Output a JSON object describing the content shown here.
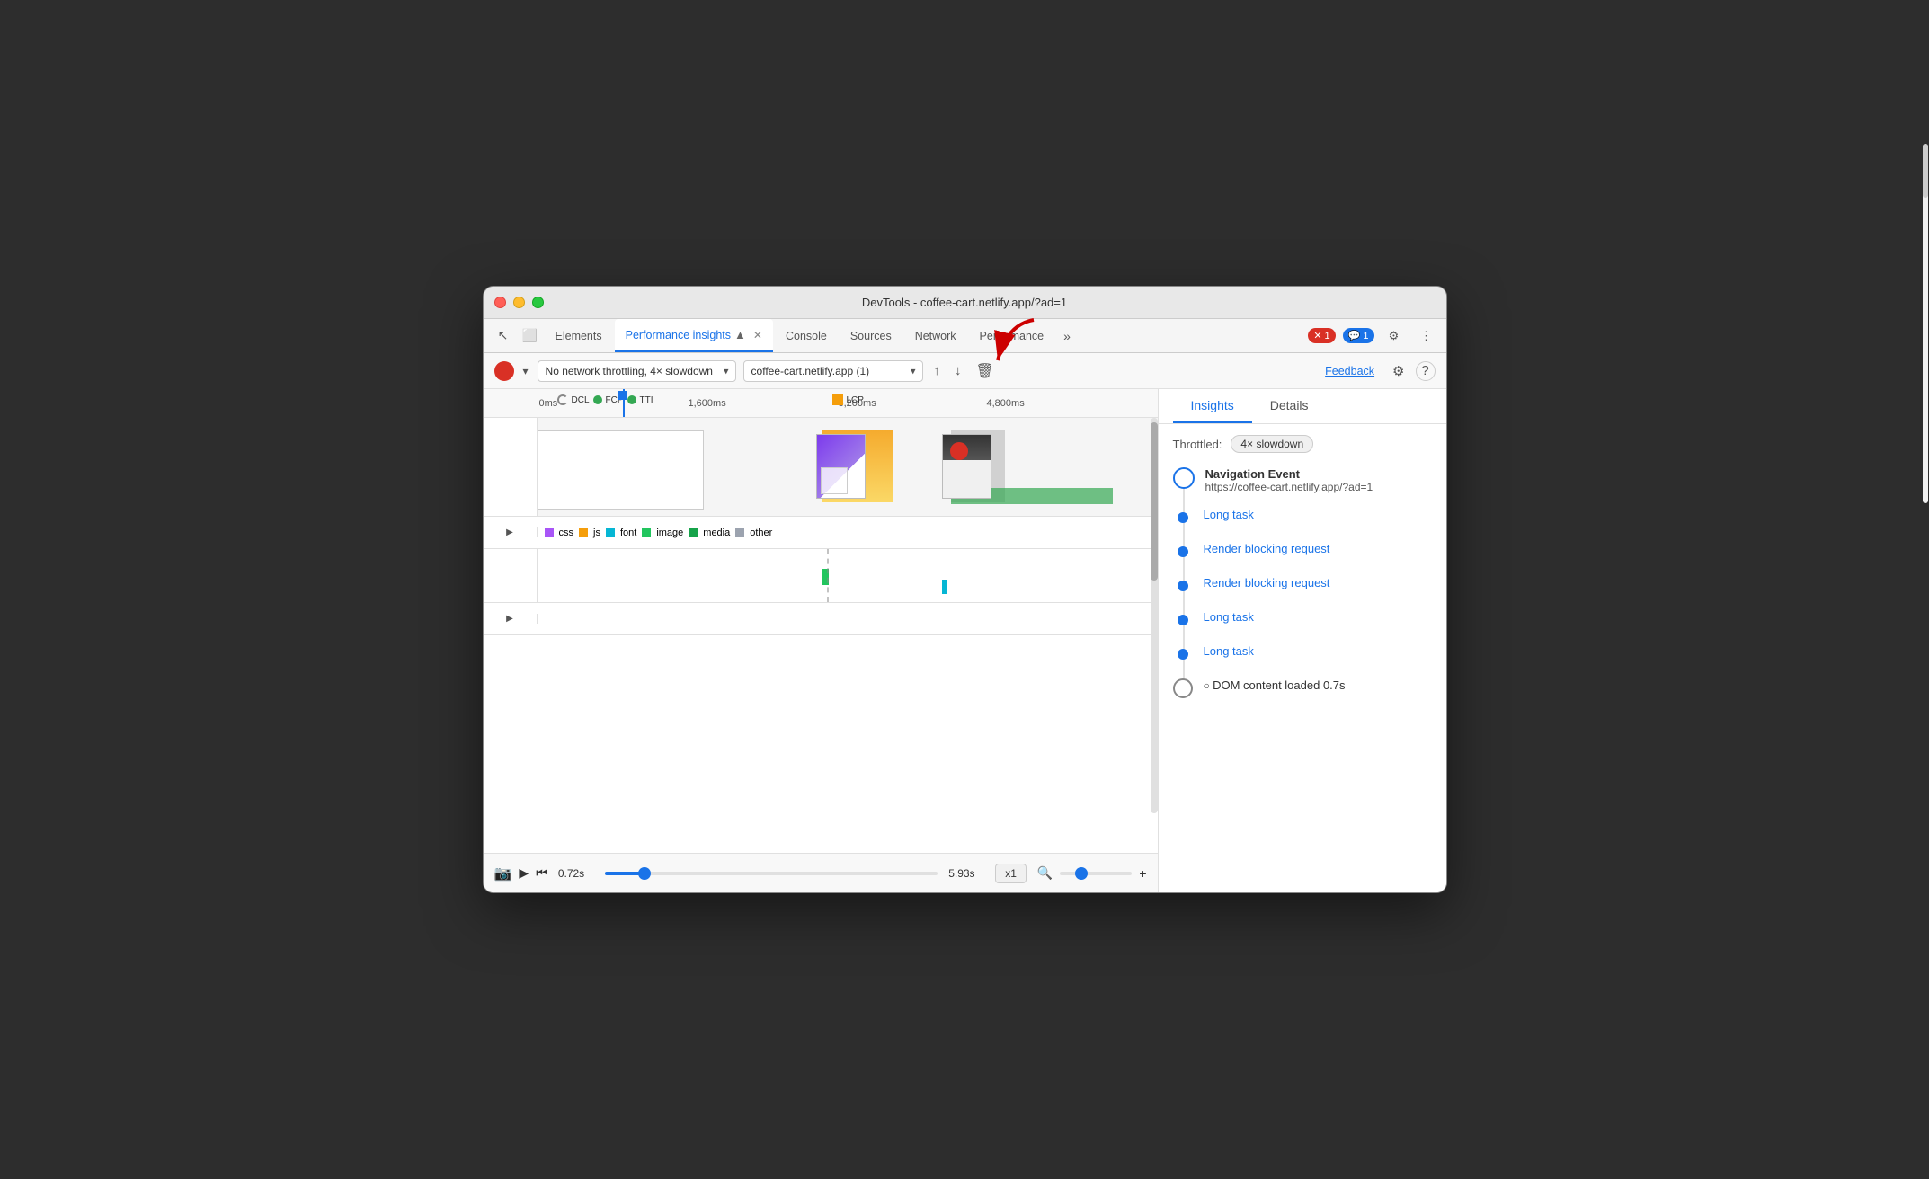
{
  "window": {
    "title": "DevTools - coffee-cart.netlify.app/?ad=1"
  },
  "tabs": [
    {
      "label": "Elements",
      "active": false
    },
    {
      "label": "Performance insights",
      "active": true
    },
    {
      "label": "Console",
      "active": false
    },
    {
      "label": "Sources",
      "active": false
    },
    {
      "label": "Network",
      "active": false
    },
    {
      "label": "Performance",
      "active": false
    }
  ],
  "toolbar": {
    "throttle_label": "No network throttling, 4× slowdown",
    "url_label": "coffee-cart.netlify.app (1)",
    "feedback_label": "Feedback"
  },
  "right_panel": {
    "tab_insights": "Insights",
    "tab_details": "Details",
    "throttle_text": "Throttled:",
    "throttle_value": "4× slowdown",
    "nav_event_title": "Navigation Event",
    "nav_event_url": "https://coffee-cart.netlify.app/?ad=1",
    "entries": [
      {
        "label": "Long task",
        "type": "link"
      },
      {
        "label": "Render blocking request",
        "type": "link"
      },
      {
        "label": "Render blocking request",
        "type": "link"
      },
      {
        "label": "Long task",
        "type": "link"
      },
      {
        "label": "Long task",
        "type": "link"
      },
      {
        "label": "DOM content loaded 0.7s",
        "type": "text"
      }
    ]
  },
  "legend": {
    "items": [
      {
        "label": "css",
        "color": "#a855f7"
      },
      {
        "label": "js",
        "color": "#f59e0b"
      },
      {
        "label": "font",
        "color": "#06b6d4"
      },
      {
        "label": "image",
        "color": "#22c55e"
      },
      {
        "label": "media",
        "color": "#16a34a"
      },
      {
        "label": "other",
        "color": "#9ca3af"
      }
    ]
  },
  "time_markers": {
    "t0": "0ms",
    "t1": "1,600ms",
    "t2": "3,200ms",
    "t3": "4,800ms"
  },
  "markers": {
    "dcl": "DCL",
    "fcp": "FCP",
    "tti": "TTI",
    "lcp": "LCP"
  },
  "bottom_bar": {
    "start_time": "0.72s",
    "end_time": "5.93s",
    "speed": "x1"
  },
  "errors": {
    "error_count": "1",
    "msg_count": "1"
  }
}
